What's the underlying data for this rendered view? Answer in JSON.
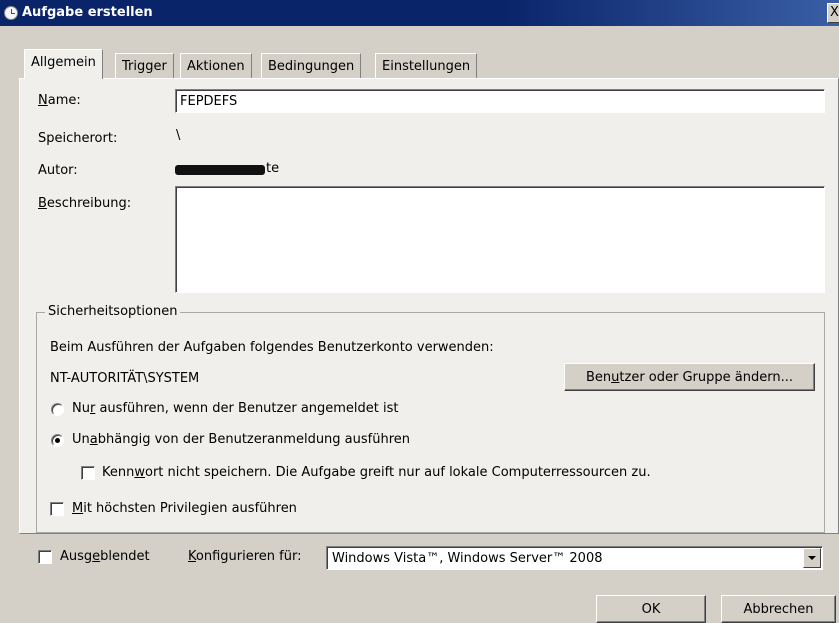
{
  "window": {
    "title": "Aufgabe erstellen",
    "close_label": "X"
  },
  "tabs": [
    {
      "label": "Allgemein",
      "active": true
    },
    {
      "label": "Trigger",
      "active": false
    },
    {
      "label": "Aktionen",
      "active": false
    },
    {
      "label": "Bedingungen",
      "active": false
    },
    {
      "label": "Einstellungen",
      "active": false
    }
  ],
  "general": {
    "name_label_pre": "",
    "name_label_u": "N",
    "name_label_post": "ame:",
    "name_value": "FEPDEFS",
    "location_label": "Speicherort:",
    "location_value": "\\",
    "author_label": "Autor:",
    "author_visible_suffix": "te",
    "description_label_u": "B",
    "description_label_post": "eschreibung:",
    "description_value": ""
  },
  "security": {
    "group_title": "Sicherheitsoptionen",
    "account_prompt": "Beim Ausführen der Aufgaben folgendes Benutzerkonto verwenden:",
    "account": "NT-AUTORITÄT\\SYSTEM",
    "change_button_pre": "Ben",
    "change_button_u": "u",
    "change_button_post": "tzer oder Gruppe ändern...",
    "radio_logged_on_pre": "Nu",
    "radio_logged_on_u": "r",
    "radio_logged_on_post": " ausführen, wenn der Benutzer angemeldet ist",
    "radio_logged_on_checked": false,
    "radio_independent_pre": "Un",
    "radio_independent_u": "a",
    "radio_independent_post": "bhängig von der Benutzeranmeldung ausführen",
    "radio_independent_checked": true,
    "no_password_pre": "Kenn",
    "no_password_u": "w",
    "no_password_post": "ort nicht speichern. Die Aufgabe greift nur auf lokale Computerressourcen zu.",
    "no_password_checked": false,
    "highest_priv_u": "M",
    "highest_priv_post": "it höchsten Privilegien ausführen",
    "highest_priv_checked": false
  },
  "bottom": {
    "hidden_pre": "Ausg",
    "hidden_u": "e",
    "hidden_post": "blendet",
    "hidden_checked": false,
    "configure_u": "K",
    "configure_post": "onfigurieren für:",
    "configure_value": "Windows Vista™, Windows Server™ 2008"
  },
  "buttons": {
    "ok": "OK",
    "cancel": "Abbrechen"
  },
  "colors": {
    "titlebar": "#0a246a",
    "dialog_bg": "#d4d0c8",
    "panel_bg": "#f0efeb"
  }
}
